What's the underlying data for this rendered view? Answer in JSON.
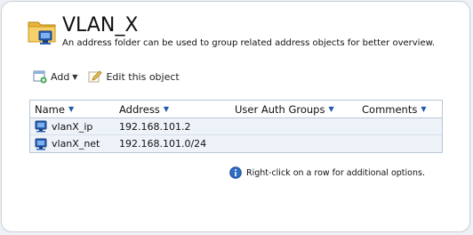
{
  "header": {
    "title": "VLAN_X",
    "subtitle": "An address folder can be used to group related address objects for better overview.",
    "icon": "address-folder-icon"
  },
  "toolbar": {
    "add_label": "Add",
    "edit_label": "Edit this object"
  },
  "grid": {
    "columns": [
      "Name",
      "Address",
      "User Auth Groups",
      "Comments"
    ],
    "rows": [
      {
        "name": "vlanX_ip",
        "address": "192.168.101.2",
        "user_auth_groups": "",
        "comments": ""
      },
      {
        "name": "vlanX_net",
        "address": "192.168.101.0/24",
        "user_auth_groups": "",
        "comments": ""
      }
    ]
  },
  "info": {
    "text": "Right-click on a row for additional options."
  },
  "colors": {
    "accent": "#1f5aa8",
    "row_bg": "#eef3f9",
    "border": "#b9c7d6"
  }
}
